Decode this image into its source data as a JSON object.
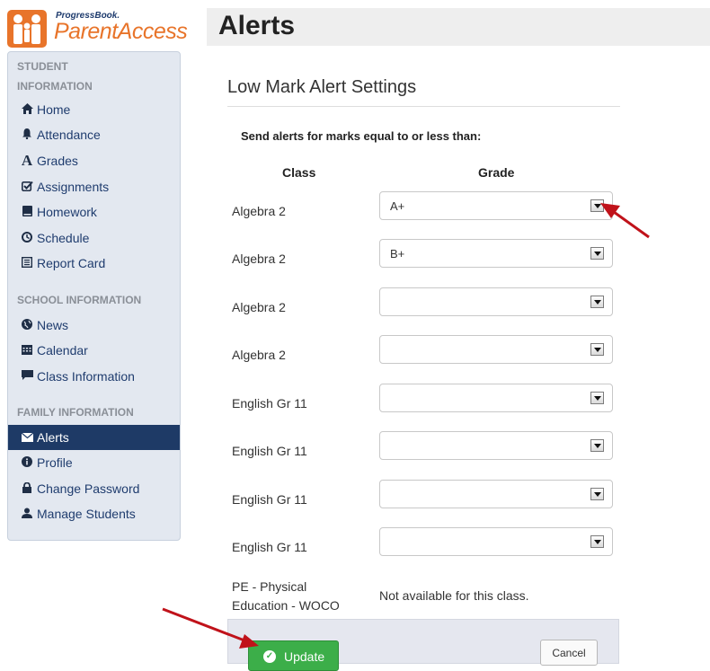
{
  "logo": {
    "small": "ProgressBook.",
    "big": "ParentAccess"
  },
  "header": {
    "title": "Alerts"
  },
  "sidebar": {
    "student_header": "STUDENT INFORMATION",
    "student_items": [
      {
        "label": "Home",
        "icon": "home-icon"
      },
      {
        "label": "Attendance",
        "icon": "bell-icon"
      },
      {
        "label": "Grades",
        "icon": "grades-icon"
      },
      {
        "label": "Assignments",
        "icon": "checkbox-icon"
      },
      {
        "label": "Homework",
        "icon": "book-icon"
      },
      {
        "label": "Schedule",
        "icon": "clock-icon"
      },
      {
        "label": "Report Card",
        "icon": "report-icon"
      }
    ],
    "school_header": "SCHOOL INFORMATION",
    "school_items": [
      {
        "label": "News",
        "icon": "globe-icon"
      },
      {
        "label": "Calendar",
        "icon": "calendar-icon"
      },
      {
        "label": "Class Information",
        "icon": "chat-icon"
      }
    ],
    "family_header": "FAMILY INFORMATION",
    "family_items": [
      {
        "label": "Alerts",
        "icon": "envelope-icon",
        "active": true
      },
      {
        "label": "Profile",
        "icon": "info-icon"
      },
      {
        "label": "Change Password",
        "icon": "lock-icon"
      },
      {
        "label": "Manage Students",
        "icon": "user-icon"
      }
    ]
  },
  "main": {
    "subtitle": "Low Mark Alert Settings",
    "instruction": "Send alerts for marks equal to or less than:",
    "col_class": "Class",
    "col_grade": "Grade",
    "rows": [
      {
        "class": "Algebra 2",
        "grade": "A+"
      },
      {
        "class": "Algebra 2",
        "grade": "B+"
      },
      {
        "class": "Algebra 2",
        "grade": ""
      },
      {
        "class": "Algebra 2",
        "grade": ""
      },
      {
        "class": "English Gr 11",
        "grade": ""
      },
      {
        "class": "English Gr 11",
        "grade": ""
      },
      {
        "class": "English Gr 11",
        "grade": ""
      },
      {
        "class": "English Gr 11",
        "grade": ""
      }
    ],
    "pe_class_line1": "PE - Physical",
    "pe_class_line2": "Education - WOCO",
    "pe_note": "Not available for this class."
  },
  "buttons": {
    "update": "Update",
    "cancel": "Cancel"
  },
  "colors": {
    "accent": "#1e3a66",
    "logo": "#e8742a",
    "update": "#3cae49",
    "annotation_arrow": "#c0121a"
  }
}
